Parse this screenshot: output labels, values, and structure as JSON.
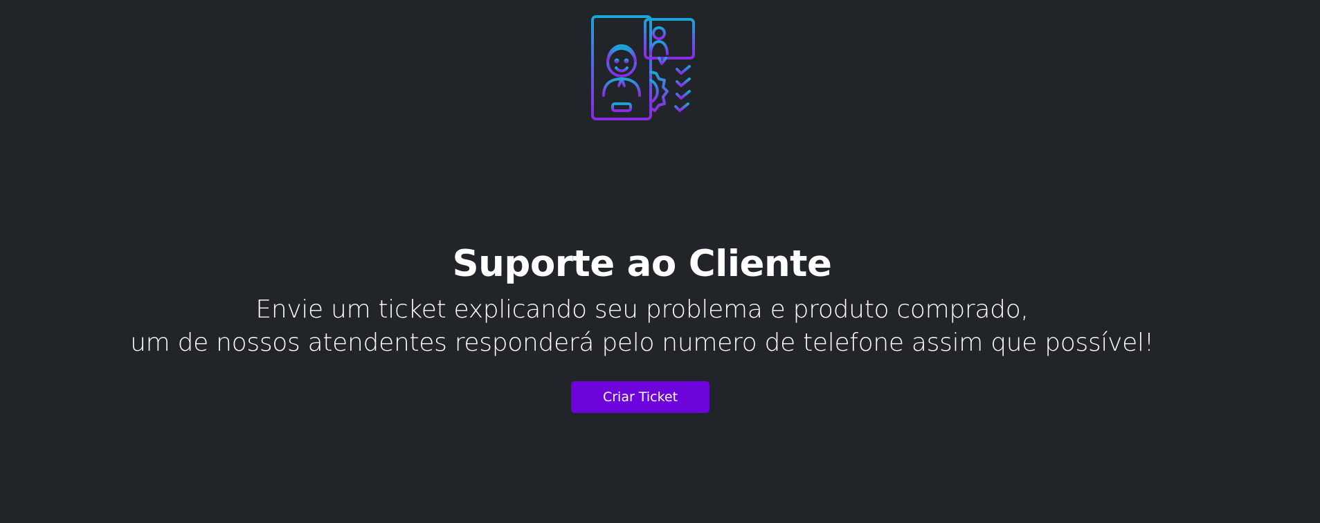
{
  "hero": {
    "icon": "customer-support-phone-icon",
    "gradient_top": "#1aa7d6",
    "gradient_bottom": "#8a2be2"
  },
  "title": "Suporte ao Cliente",
  "subtitle": {
    "line1": "Envie um ticket explicando seu problema e produto comprado,",
    "line2": "um de nossos atendentes responderá pelo numero de telefone assim que possível!"
  },
  "actions": {
    "create_ticket_label": "Criar Ticket"
  },
  "colors": {
    "background": "#212429",
    "button": "#6d04dc",
    "text": "#ffffff"
  }
}
